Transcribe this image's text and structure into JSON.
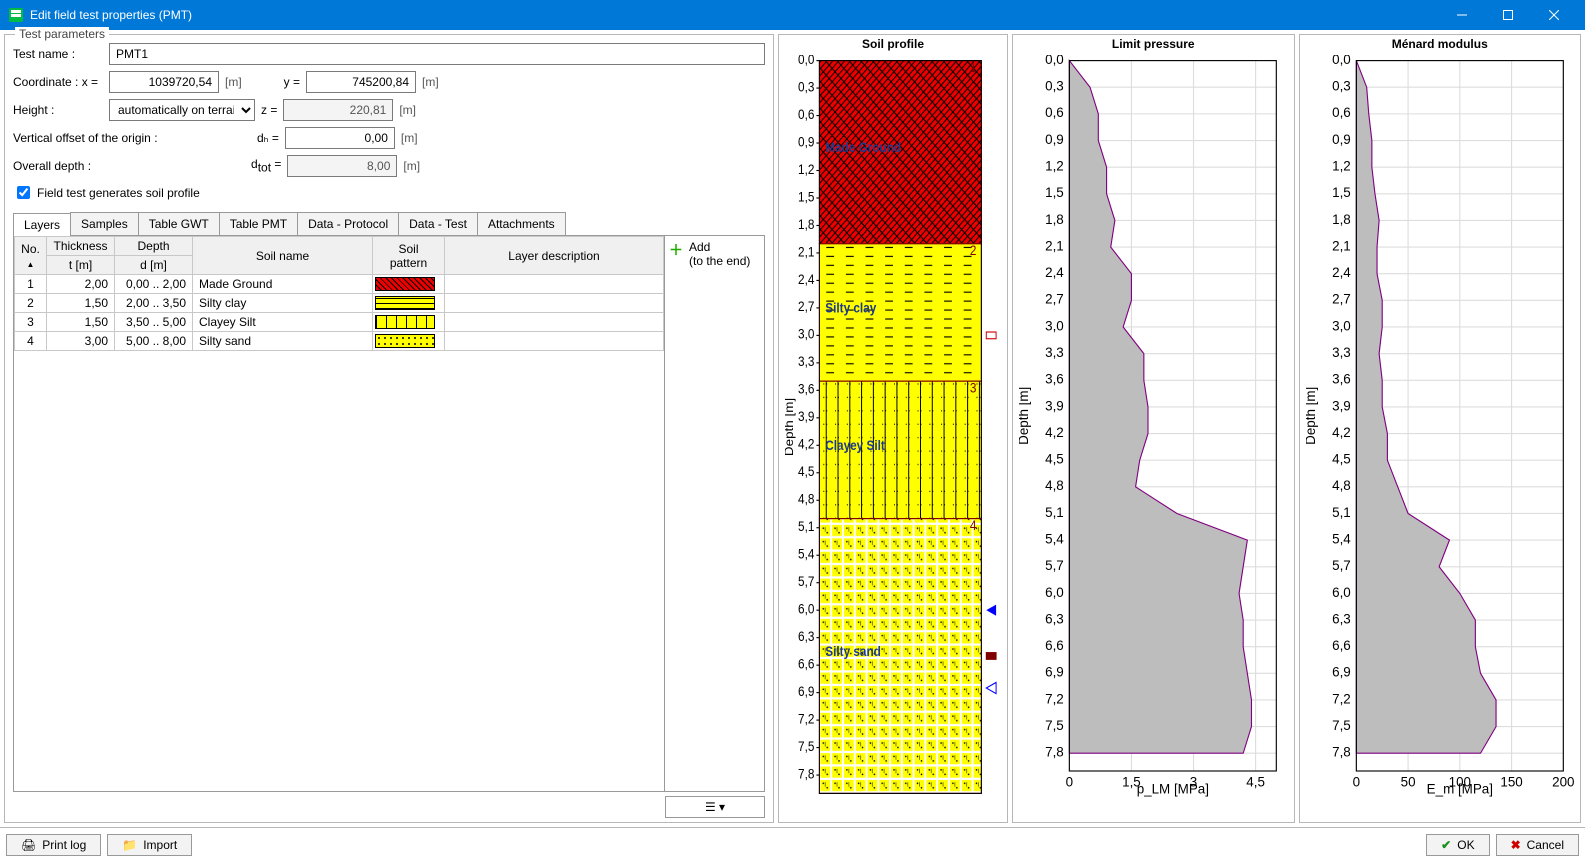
{
  "window": {
    "title": "Edit field test properties (PMT)"
  },
  "fieldset": "Test parameters",
  "form": {
    "test_name_label": "Test name :",
    "test_name_value": "PMT1",
    "coord_label": "Coordinate : x =",
    "x_value": "1039720,54",
    "y_label": "y =",
    "y_value": "745200,84",
    "height_label": "Height :",
    "height_mode": "automatically on terrain",
    "z_label": "z =",
    "z_value": "220,81",
    "offset_label": "Vertical offset of the origin :",
    "dh_label": "dₕ =",
    "dh_value": "0,00",
    "depth_label": "Overall depth :",
    "dtot_label": "d_tot =",
    "dtot_value": "8,00",
    "unit_m": "[m]",
    "chk_label": "Field test generates soil profile"
  },
  "tabs": [
    "Layers",
    "Samples",
    "Table GWT",
    "Table PMT",
    "Data - Protocol",
    "Data - Test",
    "Attachments"
  ],
  "table": {
    "headers": {
      "no": "No.",
      "thick1": "Thickness",
      "thick2": "t [m]",
      "depth1": "Depth",
      "depth2": "d [m]",
      "name": "Soil name",
      "pattern": "Soil pattern",
      "desc": "Layer description"
    },
    "rows": [
      {
        "no": "1",
        "t": "2,00",
        "d": "0,00 .. 2,00",
        "name": "Made Ground",
        "pat": "pat-red"
      },
      {
        "no": "2",
        "t": "1,50",
        "d": "2,00 .. 3,50",
        "name": "Silty clay",
        "pat": "pat-yel1"
      },
      {
        "no": "3",
        "t": "1,50",
        "d": "3,50 .. 5,00",
        "name": "Clayey Silt",
        "pat": "pat-yel2"
      },
      {
        "no": "4",
        "t": "3,00",
        "d": "5,00 .. 8,00",
        "name": "Silty sand",
        "pat": "pat-yel3"
      }
    ]
  },
  "side": {
    "add1": "Add",
    "add2": "(to the end)"
  },
  "charts": {
    "profile": {
      "title": "Soil profile",
      "ylabel": "Depth [m]",
      "layers": [
        {
          "name": "Made Ground",
          "from": 0,
          "to": 2.0,
          "fill": "red-hatch"
        },
        {
          "name": "Silty clay",
          "from": 2.0,
          "to": 3.5,
          "fill": "yellow-dash"
        },
        {
          "name": "Clayey Silt",
          "from": 3.5,
          "to": 5.0,
          "fill": "yellow-vert"
        },
        {
          "name": "Silty sand",
          "from": 5.0,
          "to": 8.0,
          "fill": "yellow-dots"
        }
      ],
      "markers": [
        {
          "depth": 3.0,
          "kind": "rect-red"
        },
        {
          "depth": 6.0,
          "kind": "tri-blue"
        },
        {
          "depth": 6.5,
          "kind": "rect-darkred"
        },
        {
          "depth": 6.85,
          "kind": "tri-open-blue"
        }
      ]
    },
    "limit": {
      "title": "Limit pressure",
      "xlabel": "p_LM [MPa]"
    },
    "menard": {
      "title": "Ménard modulus",
      "xlabel": "E_m [MPa]"
    }
  },
  "chart_data": [
    {
      "type": "line",
      "title": "Limit pressure",
      "ylabel": "Depth [m]",
      "xlabel": "p_LM [MPa]",
      "ylim": [
        0,
        8
      ],
      "xlim": [
        0,
        5
      ],
      "xticks": [
        0,
        1.5,
        3.0,
        4.5
      ],
      "x": [
        0.0,
        0.5,
        0.7,
        0.7,
        0.9,
        0.9,
        1.1,
        1.0,
        1.5,
        1.5,
        1.3,
        1.8,
        1.8,
        1.9,
        1.9,
        1.7,
        1.6,
        2.6,
        4.3,
        4.2,
        4.1,
        4.2,
        4.2,
        4.3,
        4.4,
        4.4,
        4.2
      ],
      "y": [
        0.0,
        0.3,
        0.6,
        0.9,
        1.2,
        1.5,
        1.8,
        2.1,
        2.4,
        2.7,
        3.0,
        3.3,
        3.6,
        3.9,
        4.2,
        4.5,
        4.8,
        5.1,
        5.4,
        5.7,
        6.0,
        6.3,
        6.6,
        6.9,
        7.2,
        7.5,
        7.8
      ]
    },
    {
      "type": "line",
      "title": "Ménard modulus",
      "ylabel": "Depth [m]",
      "xlabel": "E_m [MPa]",
      "ylim": [
        0,
        8
      ],
      "xlim": [
        0,
        200
      ],
      "xticks": [
        0,
        50,
        100,
        150,
        200
      ],
      "x": [
        0,
        10,
        12,
        15,
        15,
        18,
        22,
        20,
        20,
        25,
        25,
        22,
        25,
        25,
        30,
        30,
        40,
        50,
        90,
        80,
        100,
        115,
        115,
        120,
        135,
        135,
        120
      ],
      "y": [
        0.0,
        0.3,
        0.6,
        0.9,
        1.2,
        1.5,
        1.8,
        2.1,
        2.4,
        2.7,
        3.0,
        3.3,
        3.6,
        3.9,
        4.2,
        4.5,
        4.8,
        5.1,
        5.4,
        5.7,
        6.0,
        6.3,
        6.6,
        6.9,
        7.2,
        7.5,
        7.8
      ]
    }
  ],
  "footer": {
    "printlog": "Print log",
    "import": "Import",
    "ok": "OK",
    "cancel": "Cancel"
  }
}
